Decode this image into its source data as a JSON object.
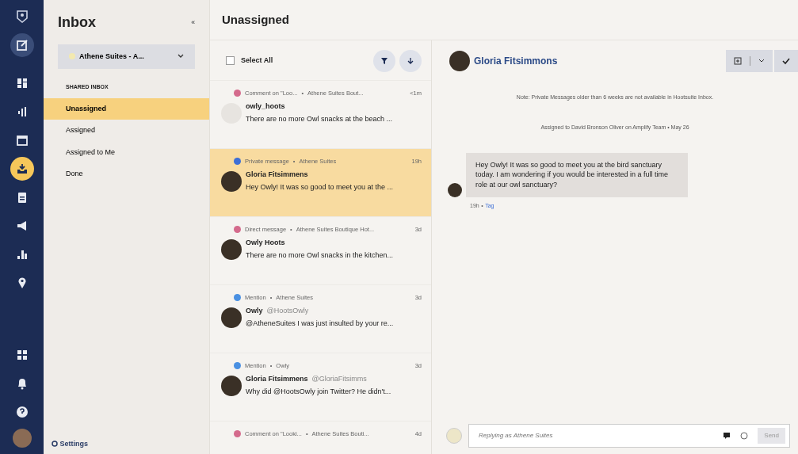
{
  "rail": [
    {
      "selected": false
    },
    {
      "selected": false
    },
    {
      "selected": false
    },
    {
      "selected": false
    },
    {
      "selected": true
    },
    {
      "selected": false
    },
    {
      "selected": false
    },
    {
      "selected": false
    },
    {
      "selected": false
    }
  ],
  "sidebar": {
    "title": "Inbox",
    "collapse": "«",
    "account": "Athene Suites - A...",
    "section": "SHARED INBOX",
    "items": [
      {
        "label": "Unassigned",
        "selected": true
      },
      {
        "label": "Assigned",
        "selected": false
      },
      {
        "label": "Assigned to Me",
        "selected": false
      },
      {
        "label": "Done",
        "selected": false
      }
    ],
    "settings": "Settings"
  },
  "list": {
    "title": "Unassigned",
    "select_all": {
      "label": "Select All",
      "checked": false
    },
    "messages": [
      {
        "color": "#d46a8c",
        "type": "Comment on \"Loo...",
        "sep": "•",
        "account": "Athene Suites Bout...",
        "time": "<1m",
        "name": "owly_hoots",
        "preview": "There are no more Owl snacks at the beach ...",
        "selected": false
      },
      {
        "color": "#3d6fd6",
        "type": "Private message",
        "sep": "•",
        "account": "Athene Suites",
        "time": "19h",
        "name": "Gloria Fitsimmens",
        "preview": "Hey Owly! It was so good to meet you at the ...",
        "selected": true
      },
      {
        "color": "#d46a8c",
        "type": "Direct message",
        "sep": "•",
        "account": "Athene Suites Boutique Hot...",
        "time": "3d",
        "name": "Owly Hoots",
        "preview": "There are no more Owl snacks in the kitchen...",
        "selected": false
      },
      {
        "color": "#4a90e2",
        "type": "Mention",
        "sep": "•",
        "account": "Athene Suites",
        "time": "3d",
        "name": "Owly",
        "handle": "@HootsOwly",
        "preview": "@AtheneSuites I was just insulted by your re...",
        "selected": false
      },
      {
        "color": "#4a90e2",
        "type": "Mention",
        "sep": "•",
        "account": "Owly",
        "time": "3d",
        "name": "Gloria Fitsimmens",
        "handle": "@GloriaFitsimms",
        "preview": "Why did @HootsOwly join Twitter? He didn't...",
        "selected": false
      },
      {
        "color": "#d46a8c",
        "type": "Comment on \"Looki...",
        "sep": "•",
        "account": "Athene Suites Bouti...",
        "time": "4d",
        "selected": false
      }
    ]
  },
  "detail": {
    "name": "Gloria Fitsimmons",
    "note": "Note: Private Messages older than 6 weeks are not available in Hootsuite Inbox.",
    "assignment": "Assigned to David Bronson Oliver on Amplify Team  •  May 26",
    "message": {
      "text": "Hey Owly! It was so good to meet you at the bird sanctuary today. I am wondering if you would be interested in a full time role at our owl sanctuary?",
      "time": "19h",
      "sep": "•",
      "tag": "Tag"
    },
    "reply": {
      "placeholder": "Replying as Athene Suites",
      "send": "Send"
    }
  }
}
